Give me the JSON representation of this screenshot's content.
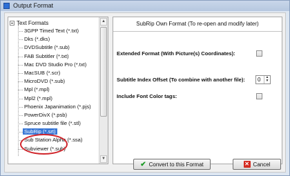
{
  "window": {
    "title": "Output Format"
  },
  "tree": {
    "root_label": "Text Formats",
    "items": [
      "3GPP Timed Text (*.txt)",
      "Dks (*.dks)",
      "DVDSubtitle (*.sub)",
      "FAB Subtitler (*.txt)",
      "Mac DVD Studio Pro (*.txt)",
      "MacSUB (*.scr)",
      "MicroDVD (*.sub)",
      "Mpl (*.mpl)",
      "Mpl2 (*.mpl)",
      "Phoenix Japanimation (*.pjs)",
      "PowerDivX (*.psb)",
      "Spruce subtitle file (*.stl)",
      "SubRip (*.srt)",
      "Sub Station Alpha (*.ssa)",
      "Subviewer (*.sub)"
    ],
    "selected": "SubRip (*.srt)"
  },
  "panel": {
    "header": "SubRip Own Format (To re-open and modify later)",
    "extended_format_label": "Extended Format (With Picture(s) Coordinates):",
    "index_offset_label": "Subtitle Index Offset (To combine with another file):",
    "index_offset_value": "0",
    "font_color_label": "Include Font Color tags:"
  },
  "buttons": {
    "convert_label": "Convert to this Format",
    "cancel_label": "Cancel"
  },
  "colors": {
    "selection": "#3a78d6",
    "annotation_circle": "#d0242a",
    "confirm_icon": "#1c9a25",
    "cancel_icon": "#d42b21"
  }
}
